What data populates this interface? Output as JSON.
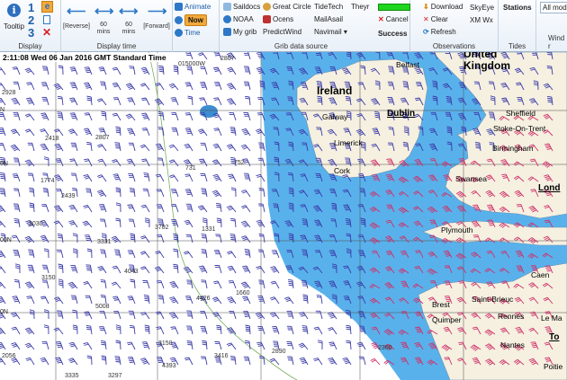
{
  "ribbon": {
    "display": {
      "label": "Display",
      "tooltip": "Tooltip",
      "num1": "1",
      "num2": "2",
      "num3": "3"
    },
    "display_time": {
      "label": "Display time",
      "reverse": "[Reverse]",
      "forward": "[Forward]",
      "mins_back": "60\nmins",
      "mins_fwd": "60\nmins",
      "animate": "Animate",
      "now": "Now",
      "time": "Time"
    },
    "grib_source": {
      "label": "Grib data source",
      "saildocs": "Saildocs",
      "great_circle": "Great Circle",
      "tidetech": "TideTech",
      "theyr": "Theyr",
      "noaa": "NOAA",
      "ocens": "Ocens",
      "mailasail": "MailAsail",
      "my_grib": "My grib",
      "predictwind": "PredictWind",
      "navimail": "Navimail ▾",
      "cancel": "Cancel",
      "success": "Success"
    },
    "observations": {
      "label": "Observations",
      "download": "Download",
      "skyeye": "SkyEye",
      "clear": "Clear",
      "xmwx": "XM Wx",
      "refresh": "Refresh"
    },
    "tides": {
      "label": "Tides",
      "stations": "Stations"
    },
    "wind": {
      "label": "Wind r",
      "all_models": "All mode"
    }
  },
  "map": {
    "status_time": "2:11:08 Wed 06 Jan 2016 GMT Standard Time",
    "lon_label": "015000W",
    "contours": [
      "2807",
      "2928",
      "2418",
      "2807",
      "1774",
      "2439",
      "3030",
      "3331",
      "2807",
      "4043",
      "3150",
      "3702",
      "731",
      "752",
      "1331",
      "1660",
      "4426",
      "5008",
      "3150",
      "3416",
      "2056",
      "3335",
      "3297",
      "4393",
      "2890",
      "2360"
    ],
    "lat_labels": [
      "N",
      "0N",
      "00N",
      "0N"
    ],
    "places": {
      "united_kingdom": "United\nKingdom",
      "ireland": "Ireland",
      "belfast": "Belfast",
      "galway": "Galway",
      "dublin": "Dublin",
      "limerick": "Limerick",
      "cork": "Cork",
      "sheffield": "Sheffield",
      "stoke": "Stoke-On-Trent",
      "birmingham": "Birmingham",
      "swansea": "Swansea",
      "london": "Lond",
      "plymouth": "Plymouth",
      "caen": "Caen",
      "brest": "Brest",
      "saint_brieuc": "Saint-Brieuc",
      "quimper": "Quimper",
      "rennes": "Rennes",
      "le_mans": "Le Ma",
      "nantes": "Nantes",
      "tours": "To",
      "poitiers": "Poitie"
    }
  },
  "colors": {
    "wind_barb": "#3a3aa8",
    "wind_barb_strong": "#d0306a",
    "land": "#f5f0e0",
    "wind_field": "#3ca3e8",
    "ribbon_accent": "#2d79c7",
    "now_button": "#f2a93a",
    "success_bar": "#1ed51e"
  },
  "icons": [
    "tooltip-icon",
    "guest-mode-icon",
    "document-icon",
    "close-icon",
    "reverse-arrow-icon",
    "forward-arrow-icon",
    "animate-icon",
    "now-icon",
    "time-icon",
    "saildocs-icon",
    "great-circle-icon",
    "noaa-icon",
    "ocens-icon",
    "my-grib-icon",
    "predictwind-icon",
    "cancel-icon",
    "download-icon",
    "clear-icon",
    "refresh-icon"
  ]
}
